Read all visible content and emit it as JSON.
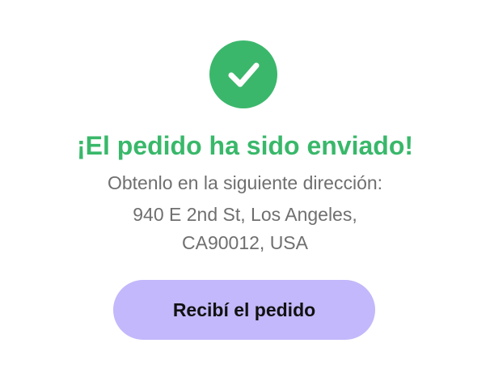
{
  "status": {
    "icon": "checkmark-circle-icon",
    "title": "¡El pedido ha sido enviado!",
    "subtitle": "Obtenlo en la siguiente dirección:",
    "address_line_1": "940 E 2nd St, Los Angeles,",
    "address_line_2": "CA90012, USA"
  },
  "actions": {
    "confirm_label": "Recibí el pedido"
  },
  "colors": {
    "success_green": "#3bb76b",
    "title_green": "#39b86a",
    "body_text": "#6f6f6f",
    "button_bg": "#c3b8fb",
    "button_text": "#111111",
    "background": "#ffffff"
  }
}
